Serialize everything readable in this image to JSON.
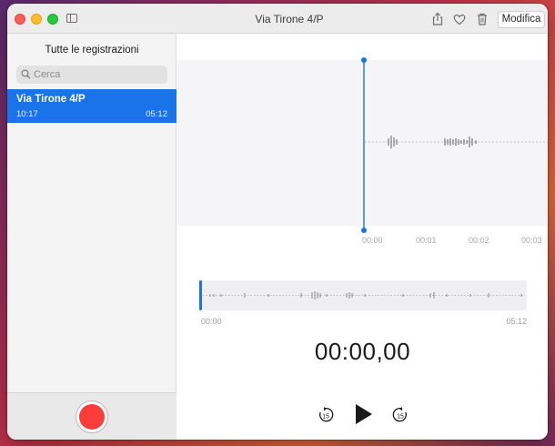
{
  "window": {
    "title": "Via Tirone 4/P",
    "edit_label": "Modifica"
  },
  "sidebar": {
    "title": "Tutte le registrazioni",
    "search_placeholder": "Cerca",
    "recordings": [
      {
        "name": "Via Tirone 4/P",
        "time": "10:17",
        "duration": "05:12",
        "selected": true
      }
    ]
  },
  "waveform": {
    "ticks": [
      "00:00",
      "00:01",
      "00:02",
      "00:03"
    ]
  },
  "overview": {
    "start": "00:00",
    "end": "05:12"
  },
  "player": {
    "timer": "00:00,00",
    "skip_back_seconds": "15",
    "skip_forward_seconds": "15"
  },
  "colors": {
    "accent": "#1a73e8",
    "record": "#fc3d39",
    "selection": "#1a73e8"
  },
  "icons": [
    "sidebar-toggle-icon",
    "share-icon",
    "heart-icon",
    "trash-icon",
    "search-icon",
    "skip-back-15-icon",
    "play-icon",
    "skip-forward-15-icon"
  ]
}
